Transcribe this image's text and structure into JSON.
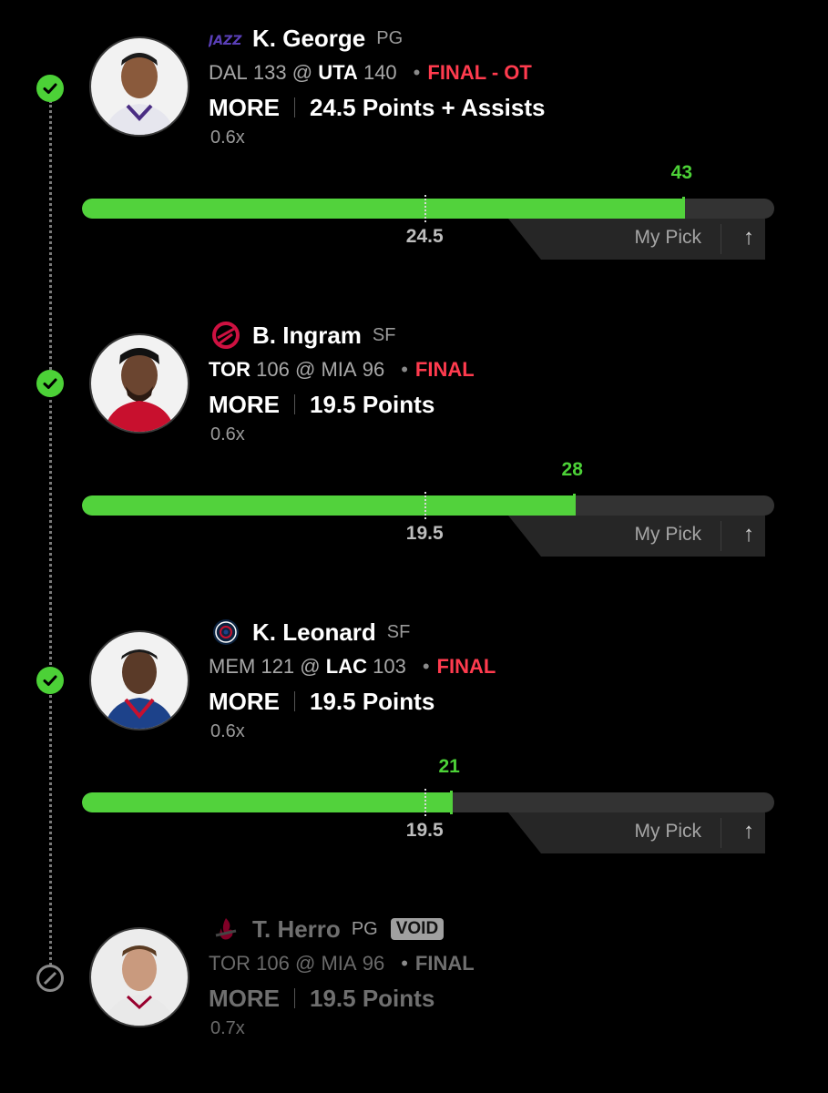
{
  "picks": [
    {
      "name": "K. George",
      "position": "PG",
      "team_logo": "jazz-logo",
      "away_team": "DAL",
      "away_score": "133",
      "at": "@",
      "home_team": "UTA",
      "home_score": "140",
      "status": "FINAL - OT",
      "direction": "MORE",
      "line_text": "24.5 Points + Assists",
      "multiplier": "0.6x",
      "result": "win",
      "actual": "43",
      "line": "24.5",
      "actual_value": 43,
      "line_value": 24.5,
      "my_pick_label": "My Pick"
    },
    {
      "name": "B. Ingram",
      "position": "SF",
      "team_logo": "raptors-logo",
      "away_team": "TOR",
      "away_score": "106",
      "at": "@",
      "home_team": "MIA",
      "home_score": "96",
      "status": "FINAL",
      "direction": "MORE",
      "line_text": "19.5 Points",
      "multiplier": "0.6x",
      "result": "win",
      "actual": "28",
      "line": "19.5",
      "actual_value": 28,
      "line_value": 19.5,
      "my_pick_label": "My Pick"
    },
    {
      "name": "K. Leonard",
      "position": "SF",
      "team_logo": "clippers-logo",
      "away_team": "MEM",
      "away_score": "121",
      "at": "@",
      "home_team": "LAC",
      "home_score": "103",
      "status": "FINAL",
      "direction": "MORE",
      "line_text": "19.5 Points",
      "multiplier": "0.6x",
      "result": "win",
      "actual": "21",
      "line": "19.5",
      "actual_value": 21,
      "line_value": 19.5,
      "my_pick_label": "My Pick"
    },
    {
      "name": "T. Herro",
      "position": "PG",
      "team_logo": "heat-logo",
      "badge": "VOID",
      "away_team": "TOR",
      "away_score": "106",
      "at": "@",
      "home_team": "MIA",
      "home_score": "96",
      "status": "FINAL",
      "direction": "MORE",
      "line_text": "19.5 Points",
      "multiplier": "0.7x",
      "result": "void"
    }
  ],
  "icons": {
    "win": "check-circle-icon",
    "void": "ban-icon",
    "arrow": "arrow-up-icon"
  },
  "colors": {
    "green": "#52d23c",
    "red": "#ff3b4e",
    "track": "#333333",
    "background": "#000000"
  }
}
